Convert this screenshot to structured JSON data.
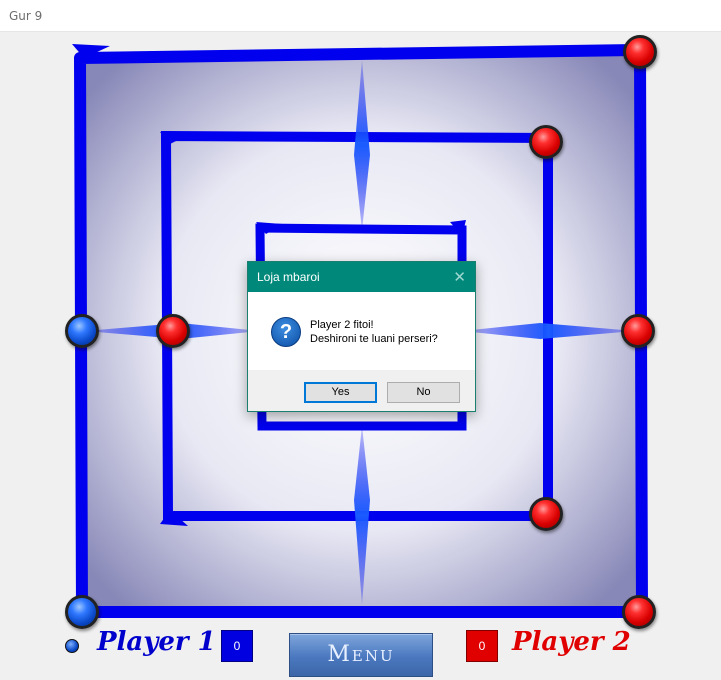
{
  "window": {
    "title": "Gur 9"
  },
  "players": {
    "p1": {
      "name": "Player 1",
      "score": "0",
      "color": "#0000cc"
    },
    "p2": {
      "name": "Player 2",
      "score": "0",
      "color": "#e00000"
    }
  },
  "menu_label": "Menu",
  "dialog": {
    "title": "Loja mbaroi",
    "line1": "Player 2 fitoi!",
    "line2": "Deshironi te luani perseri?",
    "yes_label": "Yes",
    "no_label": "No",
    "icon": "question-icon"
  },
  "board": {
    "accent": "#0000ee",
    "pieces": [
      {
        "point": "outer-top-right",
        "player": "red"
      },
      {
        "point": "middle-top-right",
        "player": "red"
      },
      {
        "point": "outer-mid-left",
        "player": "blue"
      },
      {
        "point": "middle-mid-left",
        "player": "red"
      },
      {
        "point": "outer-mid-right",
        "player": "red"
      },
      {
        "point": "middle-bottom-right",
        "player": "red"
      },
      {
        "point": "outer-bottom-left",
        "player": "blue"
      },
      {
        "point": "outer-bottom-right",
        "player": "red"
      }
    ]
  }
}
